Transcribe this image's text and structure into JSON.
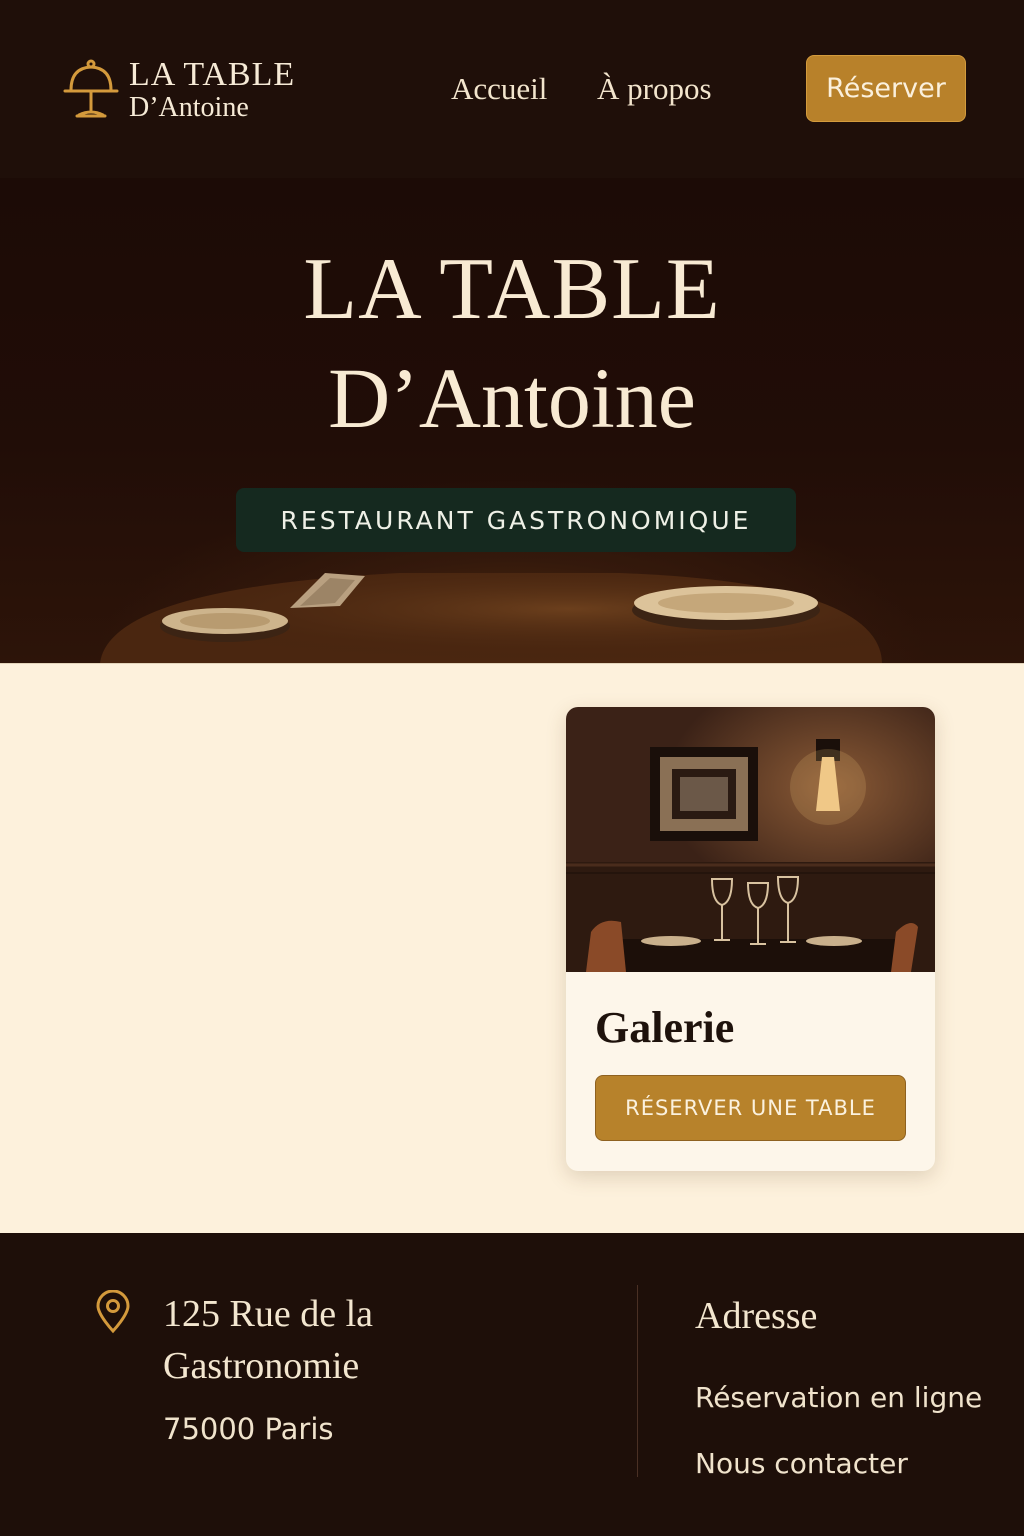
{
  "header": {
    "logo": {
      "line1": "LA TABLE",
      "line2": "D’Antoine",
      "icon": "cloche-icon"
    },
    "nav": [
      {
        "label": "Accueil"
      },
      {
        "label": "À propos"
      }
    ],
    "reserve_label": "Réserver"
  },
  "hero": {
    "title_line1": "LA TABLE",
    "title_line2": "D’Antoine",
    "badge": "RESTAURANT GASTRONOMIQUE"
  },
  "card": {
    "title": "Galerie",
    "button_label": "RÉSERVER UNE TABLE"
  },
  "footer": {
    "address_icon": "map-pin-icon",
    "address_line1": "125 Rue de la",
    "address_line2": "Gastronomie",
    "city": "75000 Paris",
    "heading": "Adresse",
    "links": [
      {
        "label": "Réservation en ligne"
      },
      {
        "label": "Nous contacter"
      }
    ]
  },
  "colors": {
    "dark_background": "#1e0f09",
    "accent_gold": "#b8812a",
    "cream": "#fdf1dc",
    "badge_green": "#15291f"
  }
}
